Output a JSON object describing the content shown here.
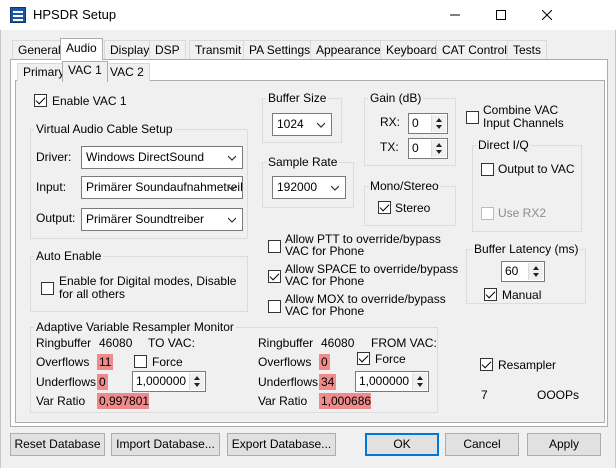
{
  "window": {
    "title": "HPSDR Setup",
    "minimize_icon": "minimize-icon",
    "maximize_icon": "maximize-icon",
    "close_icon": "close-icon"
  },
  "tabs": [
    "General",
    "Audio",
    "Display",
    "DSP",
    "Transmit",
    "PA Settings",
    "Appearance",
    "Keyboard",
    "CAT Control",
    "Tests"
  ],
  "active_tab": "Audio",
  "subtabs": [
    "Primary",
    "VAC 1",
    "VAC 2"
  ],
  "active_subtab": "VAC 1",
  "enable_vac": {
    "label": "Enable VAC 1",
    "checked": true
  },
  "vac_setup": {
    "title": "Virtual Audio Cable Setup",
    "driver_label": "Driver:",
    "driver_value": "Windows DirectSound",
    "input_label": "Input:",
    "input_value": "Primärer Soundaufnahmetreiber",
    "output_label": "Output:",
    "output_value": "Primärer Soundtreiber"
  },
  "buffer_size": {
    "title": "Buffer Size",
    "value": "1024"
  },
  "sample_rate": {
    "title": "Sample Rate",
    "value": "192000"
  },
  "gain": {
    "title": "Gain (dB)",
    "rx_label": "RX:",
    "rx_value": "0",
    "tx_label": "TX:",
    "tx_value": "0"
  },
  "mono_stereo": {
    "title": "Mono/Stereo",
    "stereo_label": "Stereo",
    "stereo_checked": true
  },
  "combine_vac": {
    "label_line1": "Combine VAC",
    "label_line2": "Input Channels",
    "checked": false
  },
  "direct_iq": {
    "title": "Direct I/Q",
    "output_label": "Output to VAC",
    "output_checked": false,
    "rx2_label": "Use RX2",
    "rx2_checked": false
  },
  "auto_enable": {
    "title": "Auto Enable",
    "label_line1": "Enable for Digital modes, Disable",
    "label_line2": "for all others",
    "checked": false
  },
  "allow_ptt": {
    "line1": "Allow PTT to override/bypass",
    "line2": "VAC for Phone",
    "checked": false
  },
  "allow_space": {
    "line1": "Allow SPACE to override/bypass",
    "line2": "VAC for Phone",
    "checked": true
  },
  "allow_mox": {
    "line1": "Allow MOX to override/bypass",
    "line2": "VAC for Phone",
    "checked": false
  },
  "buffer_latency": {
    "title": "Buffer Latency (ms)",
    "value": "60",
    "manual_label": "Manual",
    "manual_checked": true
  },
  "resampler_monitor": {
    "title": "Adaptive Variable Resampler Monitor",
    "ringbuffer_label": "Ringbuffer",
    "overflows_label": "Overflows",
    "underflows_label": "Underflows",
    "var_ratio_label": "Var Ratio",
    "force_label": "Force",
    "to_vac": {
      "heading": "TO VAC:",
      "ringbuffer": "46080",
      "overflows": "11",
      "underflows": "0",
      "var_ratio": "0,997801",
      "force_checked": false,
      "force_value": "1,000000"
    },
    "from_vac": {
      "heading": "FROM VAC:",
      "ringbuffer": "46080",
      "overflows": "0",
      "underflows": "34",
      "var_ratio": "1,000686",
      "force_checked": true,
      "force_value": "1,000000"
    }
  },
  "resampler": {
    "label": "Resampler",
    "checked": true
  },
  "ooops": {
    "count": "7",
    "label": "OOOPs"
  },
  "buttons": {
    "reset": "Reset Database",
    "import": "Import Database...",
    "export": "Export Database...",
    "ok": "OK",
    "cancel": "Cancel",
    "apply": "Apply"
  },
  "colors": {
    "highlight": "#f08b8b",
    "default_button_border": "#0078d7"
  }
}
